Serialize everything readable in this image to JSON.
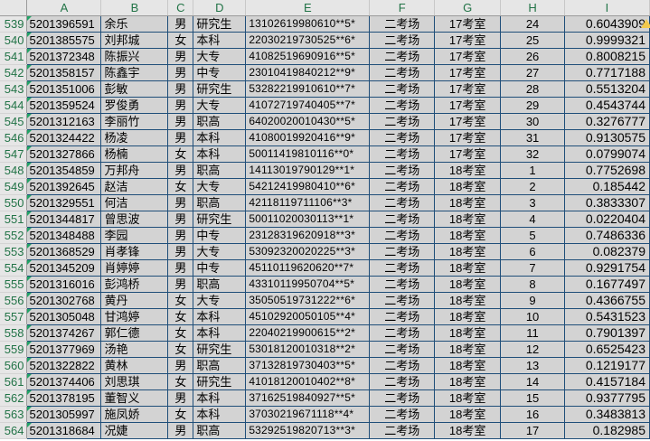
{
  "columns": [
    "A",
    "B",
    "C",
    "D",
    "E",
    "F",
    "G",
    "H",
    "I"
  ],
  "rows": [
    {
      "row": "539",
      "id": "5201396591",
      "name": "余乐",
      "gender": "男",
      "edu": "研究生",
      "idcard": "13102619980610**5*",
      "site": "二考场",
      "room": "17考室",
      "seat": "24",
      "score": "0.6043909"
    },
    {
      "row": "540",
      "id": "5201385575",
      "name": "刘邦城",
      "gender": "女",
      "edu": "本科",
      "idcard": "22030219730525**6*",
      "site": "二考场",
      "room": "17考室",
      "seat": "25",
      "score": "0.9999321"
    },
    {
      "row": "541",
      "id": "5201372348",
      "name": "陈振兴",
      "gender": "男",
      "edu": "大专",
      "idcard": "41082519690916**5*",
      "site": "二考场",
      "room": "17考室",
      "seat": "26",
      "score": "0.8008215"
    },
    {
      "row": "542",
      "id": "5201358157",
      "name": "陈鑫宇",
      "gender": "男",
      "edu": "中专",
      "idcard": "23010419840212**9*",
      "site": "二考场",
      "room": "17考室",
      "seat": "27",
      "score": "0.7717188"
    },
    {
      "row": "543",
      "id": "5201351006",
      "name": "彭敏",
      "gender": "男",
      "edu": "研究生",
      "idcard": "53282219910610**7*",
      "site": "二考场",
      "room": "17考室",
      "seat": "28",
      "score": "0.5513204"
    },
    {
      "row": "544",
      "id": "5201359524",
      "name": "罗俊勇",
      "gender": "男",
      "edu": "大专",
      "idcard": "41072719740405**7*",
      "site": "二考场",
      "room": "17考室",
      "seat": "29",
      "score": "0.4543744"
    },
    {
      "row": "545",
      "id": "5201312163",
      "name": "李丽竹",
      "gender": "男",
      "edu": "职高",
      "idcard": "64020020010430**5*",
      "site": "二考场",
      "room": "17考室",
      "seat": "30",
      "score": "0.3276777"
    },
    {
      "row": "546",
      "id": "5201324422",
      "name": "杨凌",
      "gender": "男",
      "edu": "本科",
      "idcard": "41080019920416**9*",
      "site": "二考场",
      "room": "17考室",
      "seat": "31",
      "score": "0.9130575"
    },
    {
      "row": "547",
      "id": "5201327866",
      "name": "杨楠",
      "gender": "女",
      "edu": "本科",
      "idcard": "50011419810116**0*",
      "site": "二考场",
      "room": "17考室",
      "seat": "32",
      "score": "0.0799074"
    },
    {
      "row": "548",
      "id": "5201354859",
      "name": "万邦舟",
      "gender": "男",
      "edu": "职高",
      "idcard": "14113019790129**1*",
      "site": "二考场",
      "room": "18考室",
      "seat": "1",
      "score": "0.7752698"
    },
    {
      "row": "549",
      "id": "5201392645",
      "name": "赵洁",
      "gender": "女",
      "edu": "大专",
      "idcard": "54212419980410**6*",
      "site": "二考场",
      "room": "18考室",
      "seat": "2",
      "score": "0.185442"
    },
    {
      "row": "550",
      "id": "5201329551",
      "name": "何洁",
      "gender": "男",
      "edu": "职高",
      "idcard": "42118119711106**3*",
      "site": "二考场",
      "room": "18考室",
      "seat": "3",
      "score": "0.3833307"
    },
    {
      "row": "551",
      "id": "5201344817",
      "name": "曾思波",
      "gender": "男",
      "edu": "研究生",
      "idcard": "50011020030113**1*",
      "site": "二考场",
      "room": "18考室",
      "seat": "4",
      "score": "0.0220404"
    },
    {
      "row": "552",
      "id": "5201348488",
      "name": "李园",
      "gender": "男",
      "edu": "中专",
      "idcard": "23128319620918**3*",
      "site": "二考场",
      "room": "18考室",
      "seat": "5",
      "score": "0.7486336"
    },
    {
      "row": "553",
      "id": "5201368529",
      "name": "肖孝锋",
      "gender": "男",
      "edu": "大专",
      "idcard": "53092320020225**3*",
      "site": "二考场",
      "room": "18考室",
      "seat": "6",
      "score": "0.082379"
    },
    {
      "row": "554",
      "id": "5201345209",
      "name": "肖婷婷",
      "gender": "男",
      "edu": "中专",
      "idcard": "45110119620620**7*",
      "site": "二考场",
      "room": "18考室",
      "seat": "7",
      "score": "0.9291754"
    },
    {
      "row": "555",
      "id": "5201316016",
      "name": "彭鸿桥",
      "gender": "男",
      "edu": "职高",
      "idcard": "43310119950704**5*",
      "site": "二考场",
      "room": "18考室",
      "seat": "8",
      "score": "0.1677497"
    },
    {
      "row": "556",
      "id": "5201302768",
      "name": "黄丹",
      "gender": "女",
      "edu": "大专",
      "idcard": "35050519731222**6*",
      "site": "二考场",
      "room": "18考室",
      "seat": "9",
      "score": "0.4366755"
    },
    {
      "row": "557",
      "id": "5201305048",
      "name": "甘鸿婷",
      "gender": "女",
      "edu": "本科",
      "idcard": "45102920050105**4*",
      "site": "二考场",
      "room": "18考室",
      "seat": "10",
      "score": "0.5431523"
    },
    {
      "row": "558",
      "id": "5201374267",
      "name": "郭仁德",
      "gender": "女",
      "edu": "本科",
      "idcard": "22040219900615**2*",
      "site": "二考场",
      "room": "18考室",
      "seat": "11",
      "score": "0.7901397"
    },
    {
      "row": "559",
      "id": "5201377969",
      "name": "汤艳",
      "gender": "女",
      "edu": "研究生",
      "idcard": "53018120010318**2*",
      "site": "二考场",
      "room": "18考室",
      "seat": "12",
      "score": "0.6525423"
    },
    {
      "row": "560",
      "id": "5201322822",
      "name": "黄林",
      "gender": "男",
      "edu": "职高",
      "idcard": "37132819730403**5*",
      "site": "二考场",
      "room": "18考室",
      "seat": "13",
      "score": "0.1219177"
    },
    {
      "row": "561",
      "id": "5201374406",
      "name": "刘思琪",
      "gender": "女",
      "edu": "研究生",
      "idcard": "41018120010402**8*",
      "site": "二考场",
      "room": "18考室",
      "seat": "14",
      "score": "0.4157184"
    },
    {
      "row": "562",
      "id": "5201378195",
      "name": "董智义",
      "gender": "男",
      "edu": "本科",
      "idcard": "37162519840927**5*",
      "site": "二考场",
      "room": "18考室",
      "seat": "15",
      "score": "0.9377795"
    },
    {
      "row": "563",
      "id": "5201305997",
      "name": "施凤娇",
      "gender": "女",
      "edu": "本科",
      "idcard": "37030219671118**4*",
      "site": "二考场",
      "room": "18考室",
      "seat": "16",
      "score": "0.3483813"
    },
    {
      "row": "564",
      "id": "5201318684",
      "name": "况婕",
      "gender": "男",
      "edu": "职高",
      "idcard": "53292519820713**3*",
      "site": "二考场",
      "room": "18考室",
      "seat": "17",
      "score": "0.182985"
    }
  ],
  "colors": {
    "header_bg": "#e6e6e6",
    "header_text": "#217346",
    "cell_bg": "#d3d3d3",
    "cell_border": "#1f4e79",
    "warning": "#f2c94c"
  },
  "icons": {
    "warning_marker": "warning-triangle-icon",
    "error_indicator": "green-corner-icon"
  }
}
